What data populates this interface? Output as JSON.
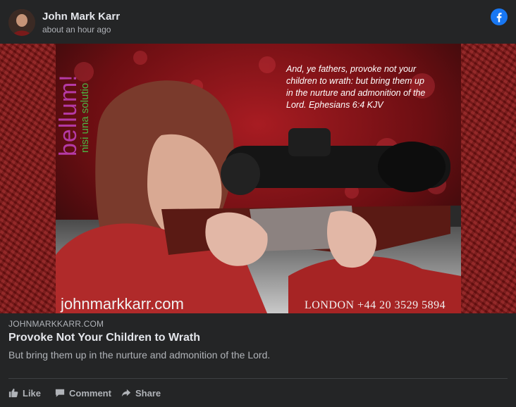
{
  "post": {
    "author": "John Mark Karr",
    "timestamp": "about an hour ago",
    "platform_icon": "facebook-icon"
  },
  "image": {
    "overlay_word_1": "bellum!",
    "overlay_word_2": "nisi una solutio",
    "verse": "And, ye fathers, provoke not your children to wrath: but bring them up in the nurture and admonition of the Lord.  Ephesians 6:4 KJV",
    "watermark_domain": "johnmarkkarr.com",
    "phone": "LONDON +44 20 3529 5894"
  },
  "link": {
    "domain": "JOHNMARKKARR.COM",
    "title": "Provoke Not Your Children to Wrath",
    "description": "But bring them up in the nurture and admonition of the Lord."
  },
  "actions": {
    "like": "Like",
    "comment": "Comment",
    "share": "Share"
  },
  "colors": {
    "background": "#242526",
    "text_primary": "#e4e6eb",
    "text_secondary": "#b0b3b8",
    "facebook_blue": "#1877f2",
    "bellum_magenta": "#b53aa5",
    "solutio_green": "#4bb543"
  }
}
